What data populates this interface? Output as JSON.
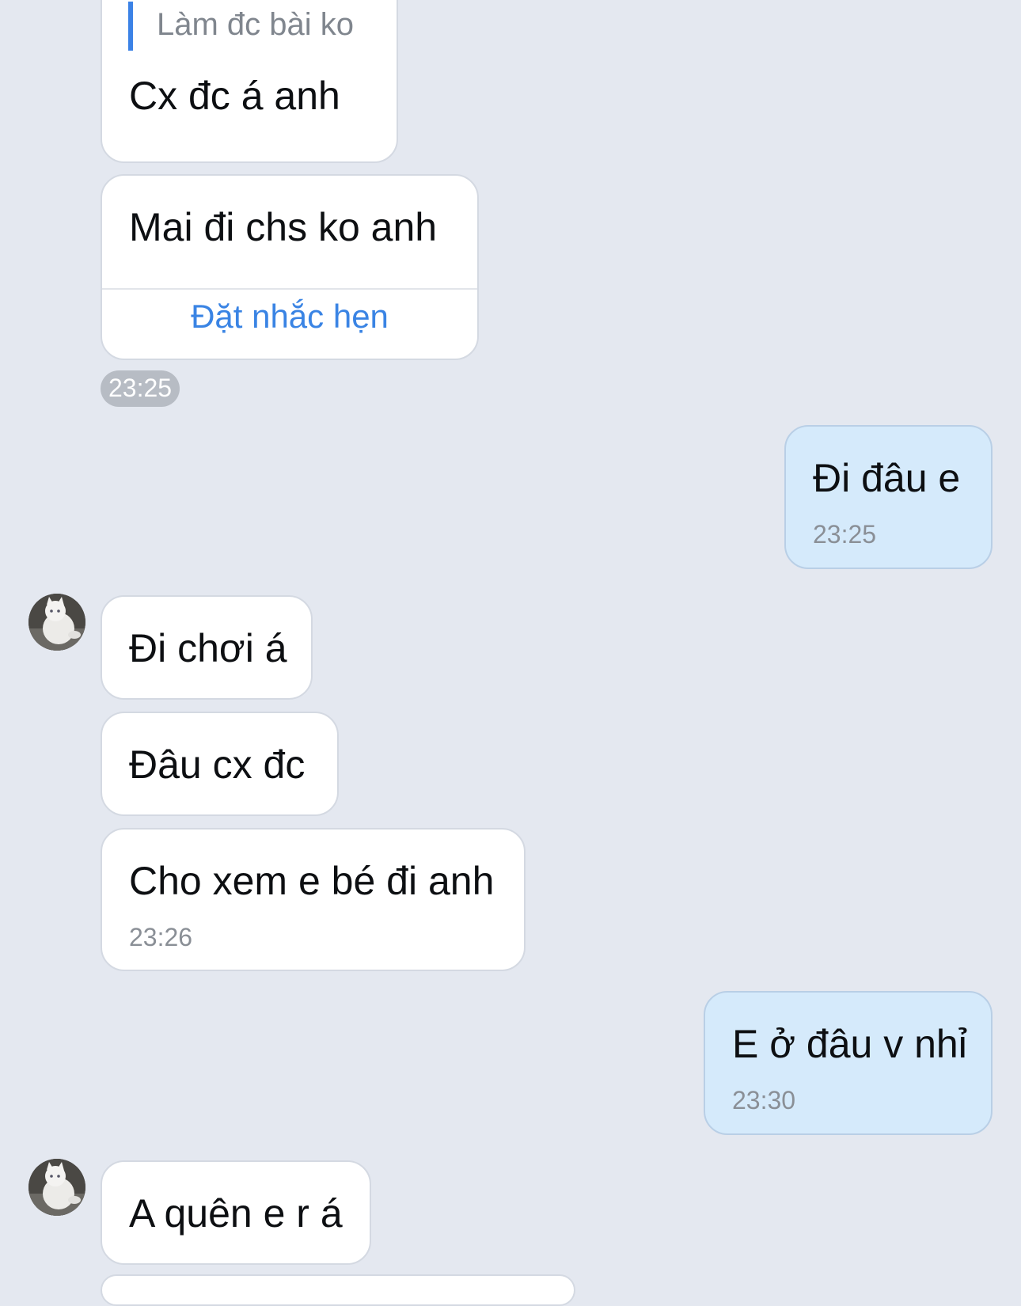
{
  "messages": {
    "m1": {
      "quote": "Làm đc bài ko",
      "text": "Cx đc á anh"
    },
    "m2": {
      "text": "Mai đi chs ko anh",
      "action": "Đặt nhắc hẹn"
    },
    "group1_time": "23:25",
    "m3": {
      "text": "Đi đâu e",
      "time": "23:25"
    },
    "m4": {
      "text": "Đi chơi á"
    },
    "m5": {
      "text": "Đâu cx đc"
    },
    "m6": {
      "text": "Cho xem e bé đi anh",
      "time": "23:26"
    },
    "m7": {
      "text": "E ở đâu v nhỉ",
      "time": "23:30"
    },
    "m8": {
      "text": "A quên e r á"
    }
  },
  "contact": {
    "avatar_icon": "cat-avatar-icon"
  },
  "colors": {
    "background": "#e4e8f0",
    "incoming_bubble": "#ffffff",
    "outgoing_bubble": "#d5eafb",
    "accent": "#3a84e4"
  }
}
